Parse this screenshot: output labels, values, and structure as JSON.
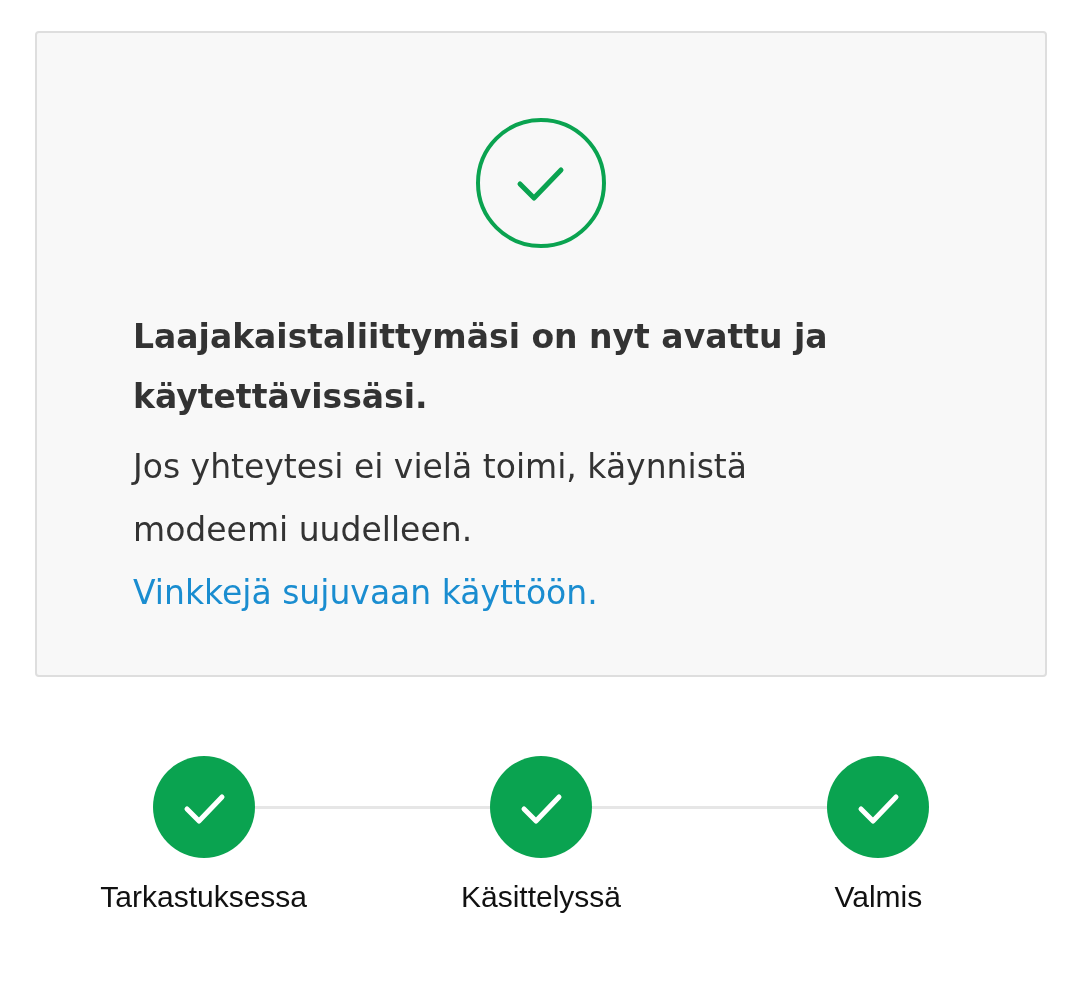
{
  "card": {
    "done": true,
    "heading": "Laajakaistaliittymäsi on nyt avattu ja käytettävissäsi.",
    "message": "Jos yhteytesi ei vielä toimi, käynnistä modeemi uudelleen.",
    "link": "Vinkkejä sujuvaan käyttöön."
  },
  "steps": [
    {
      "label": "Tarkastuksessa",
      "done": true
    },
    {
      "label": "Käsittelyssä",
      "done": true
    },
    {
      "label": "Valmis",
      "done": true
    }
  ]
}
